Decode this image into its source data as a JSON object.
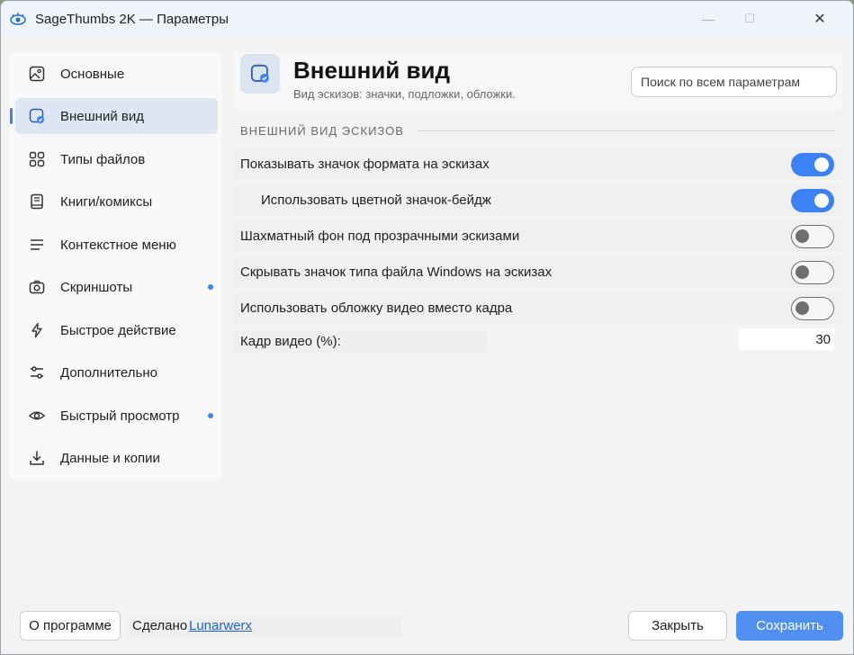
{
  "window": {
    "title": "SageThumbs 2K — Параметры",
    "min_glyph": "—",
    "max_glyph": "☐",
    "close_glyph": "✕"
  },
  "sidebar": {
    "items": [
      {
        "label": "Основные",
        "icon": "image-icon",
        "active": false,
        "dot": false
      },
      {
        "label": "Внешний вид",
        "icon": "appearance-icon",
        "active": true,
        "dot": false
      },
      {
        "label": "Типы файлов",
        "icon": "grid-icon",
        "active": false,
        "dot": false
      },
      {
        "label": "Книги/комиксы",
        "icon": "book-icon",
        "active": false,
        "dot": false
      },
      {
        "label": "Контекстное меню",
        "icon": "menu-lines-icon",
        "active": false,
        "dot": false
      },
      {
        "label": "Скриншоты",
        "icon": "camera-icon",
        "active": false,
        "dot": true
      },
      {
        "label": "Быстрое действие",
        "icon": "lightning-icon",
        "active": false,
        "dot": false
      },
      {
        "label": "Дополнительно",
        "icon": "sliders-icon",
        "active": false,
        "dot": false
      },
      {
        "label": "Быстрый просмотр",
        "icon": "eye-icon",
        "active": false,
        "dot": true
      },
      {
        "label": "Данные и копии",
        "icon": "download-icon",
        "active": false,
        "dot": false
      }
    ]
  },
  "header": {
    "title": "Внешний вид",
    "subtitle": "Вид эскизов: значки, подложки, обложки.",
    "search_placeholder": "Поиск по всем параметрам"
  },
  "section": {
    "title": "ВНЕШНИЙ ВИД ЭСКИЗОВ"
  },
  "settings": [
    {
      "label": "Показывать значок формата на эскизах",
      "on": true,
      "indent": false
    },
    {
      "label": "Использовать цветной значок-бейдж",
      "on": true,
      "indent": true
    },
    {
      "label": "Шахматный фон под прозрачными эскизами",
      "on": false,
      "indent": false
    },
    {
      "label": "Скрывать значок типа файла Windows на эскизах",
      "on": false,
      "indent": false
    },
    {
      "label": "Использовать обложку видео вместо кадра",
      "on": false,
      "indent": false
    }
  ],
  "frame": {
    "label": "Кадр видео (%):",
    "value": "30"
  },
  "footer": {
    "about_label": "О программе",
    "made_by": "Сделано",
    "made_by_link": "Lunarwerx",
    "close_label": "Закрыть",
    "save_label": "Сохранить"
  },
  "colors": {
    "accent": "#3b82f6",
    "save_button": "#4f8ff0",
    "active_nav": "#dde7f3"
  }
}
